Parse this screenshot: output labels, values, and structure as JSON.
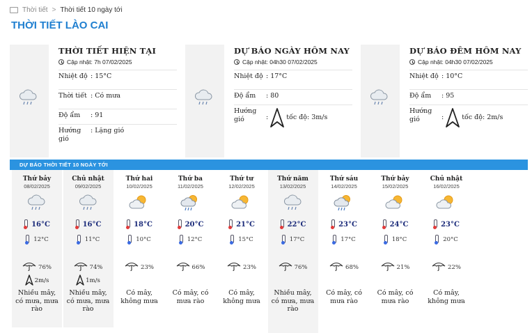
{
  "breadcrumb": {
    "home": "Thời tiết",
    "current": "Thời tiết 10 ngày tới"
  },
  "page_title": "THỜI TIẾT LÀO CAI",
  "panels": [
    {
      "title": "THỜI TIẾT HIỆN TẠI",
      "updated": "Cập nhật: 7h 07/02/2025",
      "icon": "cloud-rain-icon",
      "rows": [
        {
          "label": "Nhiệt độ",
          "value": ": 15°C"
        },
        {
          "label": "Thời tiết",
          "value": ": Có mưa"
        },
        {
          "label": "Độ ẩm",
          "value": ": 91"
        },
        {
          "label": "Hướng gió",
          "value": ": Lặng gió"
        }
      ]
    },
    {
      "title": "DỰ BÁO NGÀY HÔM NAY",
      "updated": "Cập nhật: 04h30 07/02/2025",
      "icon": "cloud-rain-icon",
      "rows": [
        {
          "label": "Nhiệt độ",
          "value": ": 17°C"
        },
        {
          "label": "Độ ẩm",
          "value": ": 80"
        },
        {
          "label": "Hướng gió",
          "value": ":",
          "wind_speed": "tốc độ: 3m/s"
        }
      ]
    },
    {
      "title": "DỰ BÁO ĐÊM HÔM NAY",
      "updated": "Cập nhật: 04h30 07/02/2025",
      "icon": "cloud-rain-icon",
      "rows": [
        {
          "label": "Nhiệt độ",
          "value": ": 10°C"
        },
        {
          "label": "Độ ẩm",
          "value": ": 95"
        },
        {
          "label": "Hướng gió",
          "value": ":",
          "wind_speed": "tốc độ: 2m/s"
        }
      ]
    }
  ],
  "forecast_header": "DỰ BÁO THỜI TIẾT 10 NGÀY TỚI",
  "days": [
    {
      "name": "Thứ bảy",
      "date": "08/02/2025",
      "icon": "cloud-rain-icon",
      "high": "16°C",
      "low": "12°C",
      "rain": "76%",
      "wind": "2m/s",
      "desc": "Nhiều mây, có mưa, mưa rào"
    },
    {
      "name": "Chủ nhật",
      "date": "09/02/2025",
      "icon": "cloud-rain-icon",
      "high": "16°C",
      "low": "11°C",
      "rain": "74%",
      "wind": "1m/s",
      "desc": "Nhiều mây, có mưa, mưa rào"
    },
    {
      "name": "Thứ hai",
      "date": "10/02/2025",
      "icon": "sun-cloud-icon",
      "high": "18°C",
      "low": "10°C",
      "rain": "23%",
      "wind": "",
      "desc": "Có mây, không mưa"
    },
    {
      "name": "Thứ ba",
      "date": "11/02/2025",
      "icon": "sun-cloud-rain-icon",
      "high": "20°C",
      "low": "12°C",
      "rain": "66%",
      "wind": "",
      "desc": "Có mây, có mưa rào"
    },
    {
      "name": "Thứ tư",
      "date": "12/02/2025",
      "icon": "sun-cloud-icon",
      "high": "21°C",
      "low": "15°C",
      "rain": "23%",
      "wind": "",
      "desc": "Có mây, không mưa"
    },
    {
      "name": "Thứ năm",
      "date": "13/02/2025",
      "icon": "cloud-rain-icon",
      "high": "22°C",
      "low": "17°C",
      "rain": "76%",
      "wind": "",
      "desc": "Nhiều mây, có mưa, mưa rào"
    },
    {
      "name": "Thứ sáu",
      "date": "14/02/2025",
      "icon": "sun-cloud-rain-icon",
      "high": "23°C",
      "low": "17°C",
      "rain": "68%",
      "wind": "",
      "desc": "Có mây, có mưa rào"
    },
    {
      "name": "Thứ bảy",
      "date": "15/02/2025",
      "icon": "sun-cloud-icon",
      "high": "24°C",
      "low": "18°C",
      "rain": "21%",
      "wind": "",
      "desc": "Có mây, có mưa rào"
    },
    {
      "name": "Chủ nhật",
      "date": "16/02/2025",
      "icon": "sun-cloud-icon",
      "high": "23°C",
      "low": "20°C",
      "rain": "22%",
      "wind": "",
      "desc": "Có mây, không mưa"
    }
  ]
}
